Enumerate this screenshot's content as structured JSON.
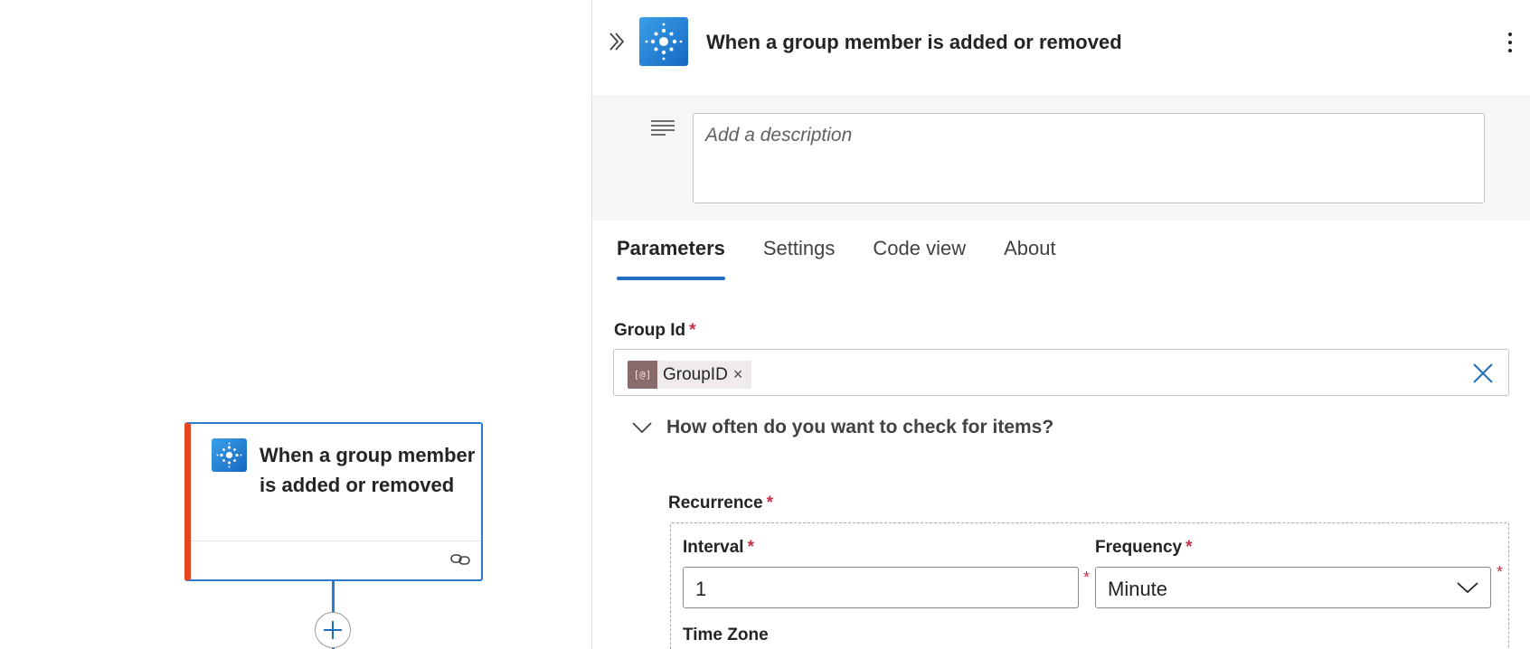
{
  "canvas": {
    "node": {
      "title": "When a group member is added or removed"
    }
  },
  "panel": {
    "title": "When a group member is added or removed",
    "description_placeholder": "Add a description",
    "tabs": [
      {
        "label": "Parameters",
        "active": true
      },
      {
        "label": "Settings",
        "active": false
      },
      {
        "label": "Code view",
        "active": false
      },
      {
        "label": "About",
        "active": false
      }
    ],
    "group_id": {
      "label": "Group Id",
      "required_mark": "*",
      "token_label": "GroupID",
      "token_remove": "×"
    },
    "check_section": {
      "label": "How often do you want to check for items?"
    },
    "recurrence": {
      "label": "Recurrence",
      "required_mark": "*",
      "interval": {
        "label": "Interval",
        "required_mark": "*",
        "value": "1"
      },
      "frequency": {
        "label": "Frequency",
        "required_mark": "*",
        "value": "Minute"
      },
      "time_zone": {
        "label": "Time Zone"
      }
    }
  },
  "colors": {
    "accent": "#1f6fbf",
    "node_border": "#2b7bd0",
    "node_error_bar": "#e4471f",
    "required": "#c4314b",
    "description_bg": "#f7f6f5",
    "token_icon_bg": "#8a6b6b"
  },
  "icons": [
    "group-trigger-icon",
    "link-icon",
    "add-icon",
    "collapse-double-chevron-icon",
    "more-options-icon",
    "description-lines-icon",
    "dynamic-content-icon",
    "clear-x-icon",
    "chevron-down-icon"
  ]
}
